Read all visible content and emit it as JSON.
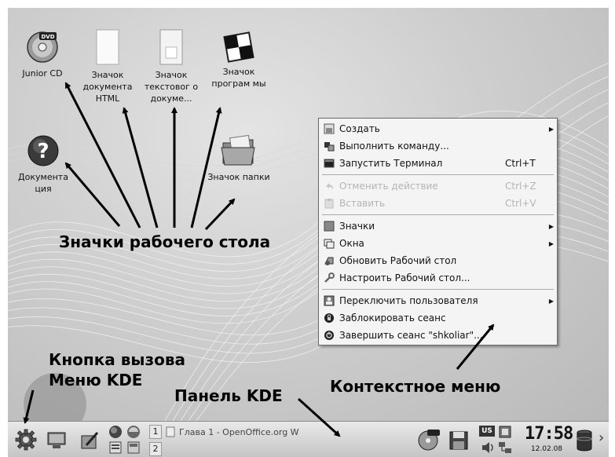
{
  "desktop": {
    "icons": [
      {
        "label": "Junior CD",
        "icon": "dvd-icon"
      },
      {
        "label": "Значок документа HTML",
        "icon": "html-document-icon"
      },
      {
        "label": "Значок текстовог о докуме...",
        "icon": "text-document-icon"
      },
      {
        "label": "Значок програм мы",
        "icon": "program-icon"
      },
      {
        "label": "Документа ция",
        "icon": "help-icon"
      },
      {
        "label": "Значок папки",
        "icon": "folder-icon"
      }
    ]
  },
  "context_menu": {
    "items": [
      {
        "label": "Создать",
        "shortcut": "",
        "submenu": true,
        "disabled": false
      },
      {
        "label": "Выполнить команду...",
        "shortcut": "",
        "submenu": false,
        "disabled": false
      },
      {
        "label": "Запустить Терминал",
        "shortcut": "Ctrl+T",
        "submenu": false,
        "disabled": false
      },
      {
        "label": "Отменить действие",
        "shortcut": "Ctrl+Z",
        "submenu": false,
        "disabled": true
      },
      {
        "label": "Вставить",
        "shortcut": "Ctrl+V",
        "submenu": false,
        "disabled": true
      },
      {
        "label": "Значки",
        "shortcut": "",
        "submenu": true,
        "disabled": false
      },
      {
        "label": "Окна",
        "shortcut": "",
        "submenu": true,
        "disabled": false
      },
      {
        "label": "Обновить Рабочий стол",
        "shortcut": "",
        "submenu": false,
        "disabled": false
      },
      {
        "label": "Настроить Рабочий стол...",
        "shortcut": "",
        "submenu": false,
        "disabled": false
      },
      {
        "label": "Переключить пользователя",
        "shortcut": "",
        "submenu": true,
        "disabled": false
      },
      {
        "label": "Заблокировать сеанс",
        "shortcut": "",
        "submenu": false,
        "disabled": false
      },
      {
        "label": "Завершить сеанс \"shkoliar\"...",
        "shortcut": "",
        "submenu": false,
        "disabled": false
      }
    ]
  },
  "annotations": {
    "desktop_icons": "Значки рабочего стола",
    "kde_menu_line1": "Кнопка вызова",
    "kde_menu_line2": "Меню KDE",
    "kde_panel": "Панель KDE",
    "context_menu": "Контекстное меню"
  },
  "panel": {
    "pager": [
      "1",
      "2"
    ],
    "task_title": "Глава 1 - OpenOffice.org W",
    "keyboard_layout": "US",
    "clock_time": "17:58",
    "clock_date": "12.02.08",
    "more_arrow": "›"
  }
}
